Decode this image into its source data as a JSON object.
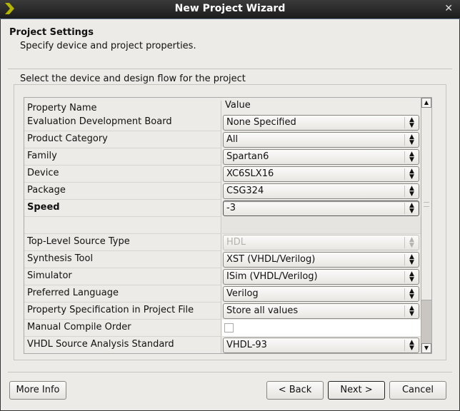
{
  "window": {
    "title": "New Project Wizard"
  },
  "header": {
    "title": "Project Settings",
    "subtitle": "Specify device and project properties."
  },
  "group": {
    "label": "Select the device and design flow for the project"
  },
  "table": {
    "columns": [
      "Property Name",
      "Value"
    ],
    "rows": [
      {
        "name": "Evaluation Development Board",
        "value": "None Specified",
        "type": "combo"
      },
      {
        "name": "Product Category",
        "value": "All",
        "type": "combo"
      },
      {
        "name": "Family",
        "value": "Spartan6",
        "type": "combo"
      },
      {
        "name": "Device",
        "value": "XC6SLX16",
        "type": "combo"
      },
      {
        "name": "Package",
        "value": "CSG324",
        "type": "combo"
      },
      {
        "name": "Speed",
        "value": "-3",
        "type": "combo",
        "bold": true,
        "active": true
      },
      {
        "name": "",
        "value": "",
        "type": "blank"
      },
      {
        "name": "Top-Level Source Type",
        "value": "HDL",
        "type": "combo",
        "disabled": true
      },
      {
        "name": "Synthesis Tool",
        "value": "XST (VHDL/Verilog)",
        "type": "combo"
      },
      {
        "name": "Simulator",
        "value": "ISim (VHDL/Verilog)",
        "type": "combo"
      },
      {
        "name": "Preferred Language",
        "value": "Verilog",
        "type": "combo"
      },
      {
        "name": "Property Specification in Project File",
        "value": "Store all values",
        "type": "combo"
      },
      {
        "name": "Manual Compile Order",
        "value": false,
        "type": "checkbox"
      },
      {
        "name": "VHDL Source Analysis Standard",
        "value": "VHDL-93",
        "type": "combo"
      }
    ]
  },
  "buttons": {
    "more_info": "More Info",
    "back": "< Back",
    "next": "Next >",
    "cancel": "Cancel"
  }
}
